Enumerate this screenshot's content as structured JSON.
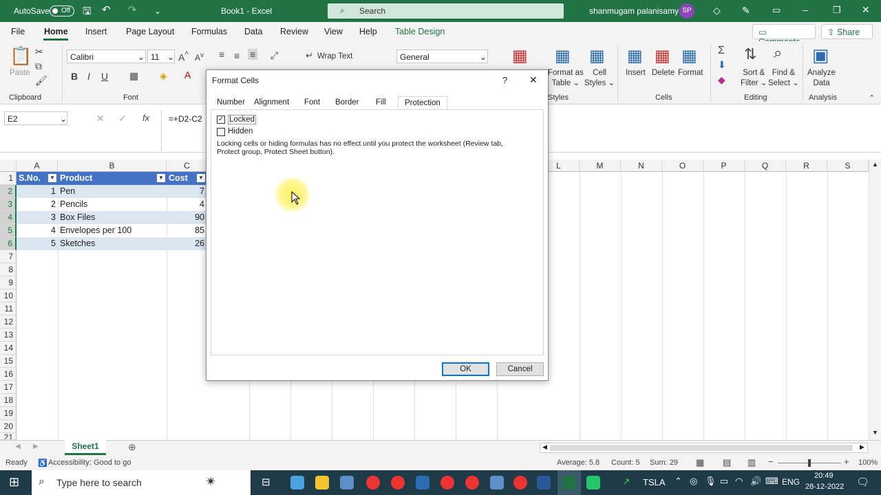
{
  "titlebar": {
    "autosave": "AutoSave",
    "autosave_state": "Off",
    "title": "Book1  -  Excel",
    "search_placeholder": "Search",
    "user": "shanmugam palanisamy",
    "initials": "SP"
  },
  "menu": {
    "file": "File",
    "home": "Home",
    "insert": "Insert",
    "page_layout": "Page Layout",
    "formulas": "Formulas",
    "data": "Data",
    "review": "Review",
    "view": "View",
    "help": "Help",
    "table_design": "Table Design",
    "comments": "Comments",
    "share": "Share"
  },
  "ribbon": {
    "paste": "Paste",
    "clipboard": "Clipboard",
    "font_name": "Calibri",
    "font_size": "11",
    "font_group": "Font",
    "wrap_text": "Wrap Text",
    "number_format": "General",
    "format_as_table_1": "Format as",
    "format_as_table_2": "Table",
    "cell_styles_1": "Cell",
    "cell_styles_2": "Styles",
    "styles": "Styles",
    "insert": "Insert",
    "delete": "Delete",
    "format": "Format",
    "cells": "Cells",
    "sort_filter_1": "Sort &",
    "sort_filter_2": "Filter",
    "find_select_1": "Find &",
    "find_select_2": "Select",
    "editing": "Editing",
    "analyze_1": "Analyze",
    "analyze_2": "Data",
    "analysis": "Analysis"
  },
  "formula_bar": {
    "name_box": "E2",
    "fx": "fx",
    "formula": "=+D2-C2"
  },
  "columns_left": [
    "A",
    "B",
    "C"
  ],
  "columns_right": [
    "L",
    "M",
    "N",
    "O",
    "P",
    "Q",
    "R",
    "S"
  ],
  "rows": [
    "1",
    "2",
    "3",
    "4",
    "5",
    "6",
    "7",
    "8",
    "9",
    "10",
    "11",
    "12",
    "13",
    "14",
    "15",
    "16",
    "17",
    "18",
    "19",
    "20",
    "21"
  ],
  "table": {
    "headers": [
      "S.No.",
      "Product",
      "Cost"
    ],
    "rows": [
      {
        "sno": "1",
        "product": "Pen",
        "cost": "7"
      },
      {
        "sno": "2",
        "product": "Pencils",
        "cost": "4"
      },
      {
        "sno": "3",
        "product": "Box Files",
        "cost": "90"
      },
      {
        "sno": "4",
        "product": "Envelopes per 100",
        "cost": "85"
      },
      {
        "sno": "5",
        "product": "Sketches",
        "cost": "26"
      }
    ]
  },
  "dialog": {
    "title": "Format Cells",
    "help": "?",
    "close": "✕",
    "tabs": [
      "Number",
      "Alignment",
      "Font",
      "Border",
      "Fill",
      "Protection"
    ],
    "locked": "Locked",
    "hidden": "Hidden",
    "note_line1": "Locking cells or hiding formulas has no effect until you protect the worksheet (Review tab,",
    "note_line2": "Protect group, Protect Sheet button).",
    "ok": "OK",
    "cancel": "Cancel"
  },
  "sheet_tab": "Sheet1",
  "status": {
    "ready": "Ready",
    "accessibility": "Accessibility: Good to go",
    "average": "Average: 5.8",
    "count": "Count: 5",
    "sum": "Sum: 29",
    "zoom": "100%"
  },
  "taskbar": {
    "search": "Type here to search",
    "ticker": "TSLA",
    "lang": "ENG",
    "time": "20:49",
    "date": "28-12-2022"
  },
  "colors": {
    "excel_green": "#217346",
    "table_header": "#4472c4",
    "band": "#dce6f1",
    "taskbar": "#1f3b4a"
  }
}
